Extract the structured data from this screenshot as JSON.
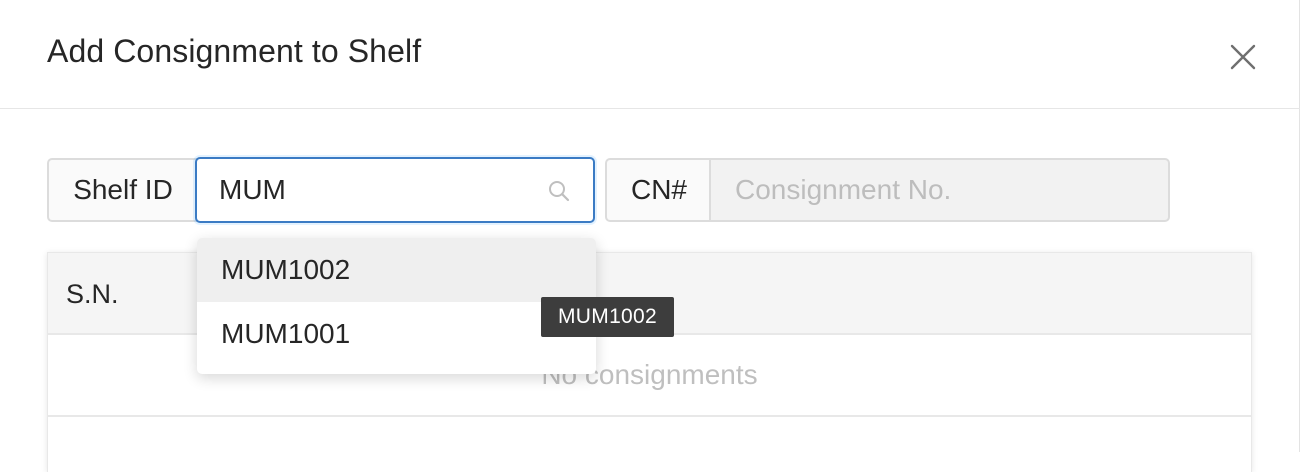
{
  "modal": {
    "title": "Add Consignment to Shelf"
  },
  "form": {
    "shelf_label": "Shelf ID",
    "shelf_value": "MUM",
    "cn_label": "CN#",
    "cn_placeholder": "Consignment No.",
    "cn_value": ""
  },
  "dropdown": {
    "options": [
      "MUM1002",
      "MUM1001"
    ],
    "active_index": 0
  },
  "tooltip": {
    "text": "MUM1002"
  },
  "table": {
    "columns": [
      "S.N."
    ],
    "empty_text": "No consignments"
  },
  "icons": {
    "close": "close-icon",
    "search": "search-icon"
  },
  "colors": {
    "focus_border": "#3b7bc4",
    "tooltip_bg": "#3d3d3d",
    "active_option": "#efefef"
  }
}
